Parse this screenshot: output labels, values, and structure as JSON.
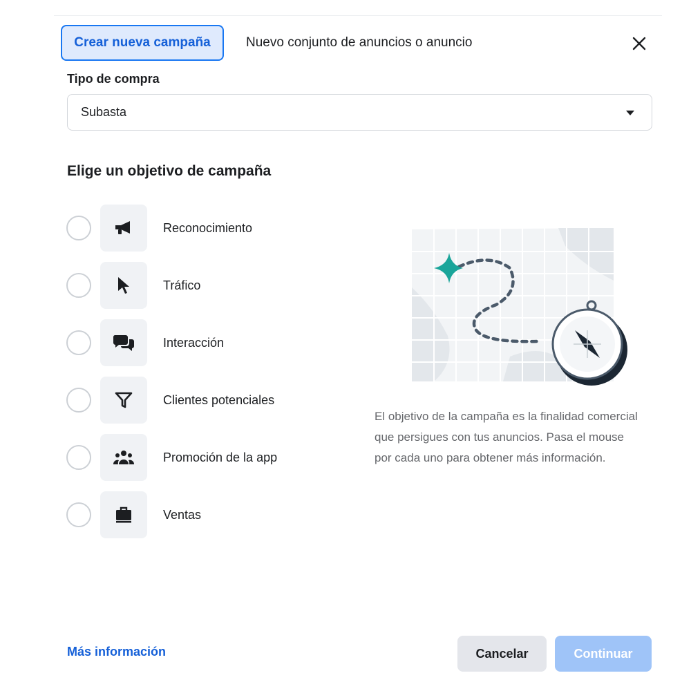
{
  "tabs": {
    "active_label": "Crear nueva campaña",
    "other_label": "Nuevo conjunto de anuncios o anuncio"
  },
  "purchase_type": {
    "label": "Tipo de compra",
    "selected_value": "Subasta"
  },
  "objective": {
    "heading": "Elige un objetivo de campaña",
    "options": [
      {
        "label": "Reconocimiento",
        "icon": "megaphone-icon"
      },
      {
        "label": "Tráfico",
        "icon": "cursor-icon"
      },
      {
        "label": "Interacción",
        "icon": "chat-bubbles-icon"
      },
      {
        "label": "Clientes potenciales",
        "icon": "funnel-icon"
      },
      {
        "label": "Promoción de la app",
        "icon": "people-icon"
      },
      {
        "label": "Ventas",
        "icon": "briefcase-icon"
      }
    ],
    "description": "El objetivo de la campaña es la finalidad comercial que persigues con tus anuncios. Pasa el mouse por cada uno para obtener más información."
  },
  "footer": {
    "more_info": "Más información",
    "cancel": "Cancelar",
    "continue": "Continuar"
  },
  "colors": {
    "accent": "#1877f2",
    "accent_light": "#dfeafd",
    "teal": "#1aa59a",
    "disabled_button": "#9fc4f8"
  }
}
